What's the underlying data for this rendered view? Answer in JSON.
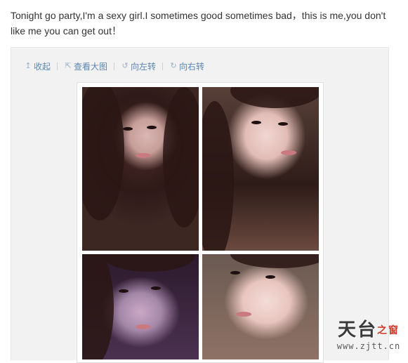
{
  "post": {
    "text": "Tonight go party,I'm a sexy girl.I sometimes good sometimes bad，this is me,you don't like me you can get out！"
  },
  "toolbar": {
    "collapse_label": "收起",
    "view_large_label": "查看大图",
    "rotate_left_label": "向左转",
    "rotate_right_label": "向右转"
  },
  "icons": {
    "collapse": "arrow-up-icon",
    "view_large": "external-view-icon",
    "rotate_left": "rotate-left-icon",
    "rotate_right": "rotate-right-icon"
  },
  "photos": [
    {
      "name": "photo-top-left"
    },
    {
      "name": "photo-top-right"
    },
    {
      "name": "photo-bottom-left"
    },
    {
      "name": "photo-bottom-right"
    }
  ],
  "watermark": {
    "logo_text": "天台",
    "logo_accent": "之窗",
    "url": "www.zjtt.cn"
  },
  "colors": {
    "link": "#5c86b3",
    "text": "#333333",
    "box_bg": "#f2f2f2"
  }
}
